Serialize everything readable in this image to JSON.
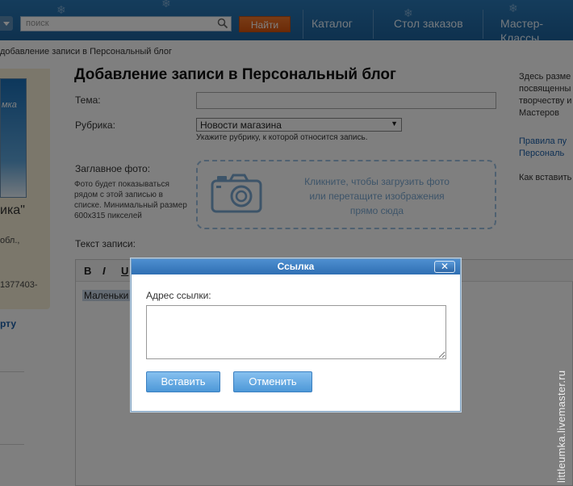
{
  "header": {
    "search_placeholder": "поиск",
    "find_button": "Найти",
    "nav": [
      "Каталог",
      "Стол заказов",
      "Мастер-Классы"
    ]
  },
  "breadcrumb": "добавление записи в Персональный блог",
  "sidebar": {
    "image_text": "мка",
    "name": "ика\"",
    "city": "обл.,",
    "phone": "1377403-",
    "link": "рту"
  },
  "main": {
    "title": "Добавление записи в Персональный блог",
    "topic_label": "Тема:",
    "topic_value": "",
    "rubric_label": "Рубрика:",
    "rubric_value": "Новости магазина",
    "rubric_hint": "Укажите рубрику, к которой относится запись.",
    "photo_label": "Заглавное фото:",
    "photo_note": "Фото будет показываться рядом с этой записью в списке. Минимальный размер 600x315 пикселей",
    "upload_text": "Кликните, чтобы загрузить фото или перетащите изображения прямо сюда",
    "body_label": "Текст записи:",
    "toolbar": [
      "B",
      "I",
      "U"
    ],
    "editor_text": "Маленьки"
  },
  "right_column": {
    "lines": [
      "Здесь разме",
      "посвященны",
      "творчеству и",
      "Мастеров"
    ],
    "link1": [
      "Правила пу",
      "Персональ"
    ],
    "link2": "Как вставить"
  },
  "dialog": {
    "title": "Ссылка",
    "close_label": "✕",
    "url_label": "Адрес ссылки:",
    "url_value": "",
    "insert_button": "Вставить",
    "cancel_button": "Отменить"
  },
  "watermark": "littleumka.livemaster.ru",
  "colors": {
    "topbar": "#1f6aa6",
    "find_button": "#e8651c",
    "dialog_title": "#2f6fb3",
    "link": "#1b5fa8"
  }
}
